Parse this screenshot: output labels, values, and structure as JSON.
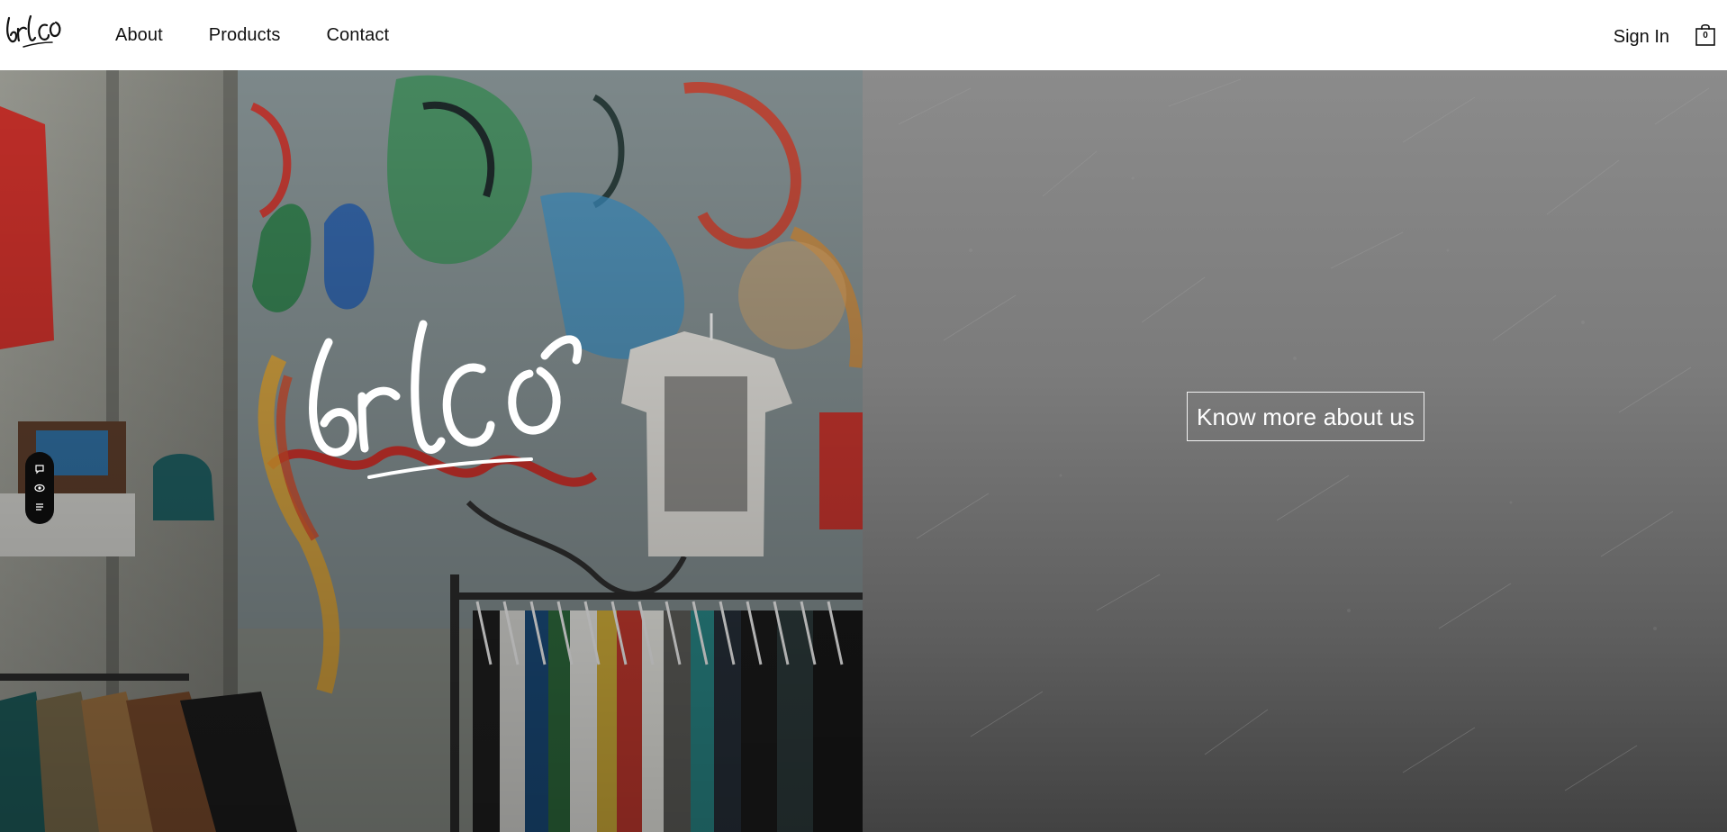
{
  "header": {
    "logo_alt": "brco logo",
    "nav": {
      "about": "About",
      "products": "Products",
      "contact": "Contact"
    },
    "sign_in": "Sign In",
    "cart_count": "0"
  },
  "hero": {
    "brand_logo": "brco",
    "cta_label": "Know more about us"
  },
  "icons": {
    "toolbar": [
      "chat-icon",
      "eye-icon",
      "list-icon"
    ],
    "cart": "shopping-bag-icon"
  },
  "colors": {
    "header_bg": "#ffffff",
    "text": "#111111",
    "hero_right_top": "#8b8b8b",
    "hero_right_bottom": "#424242",
    "cta_border": "#f2f2f2",
    "toolbar_bg": "#0b0b0b"
  }
}
